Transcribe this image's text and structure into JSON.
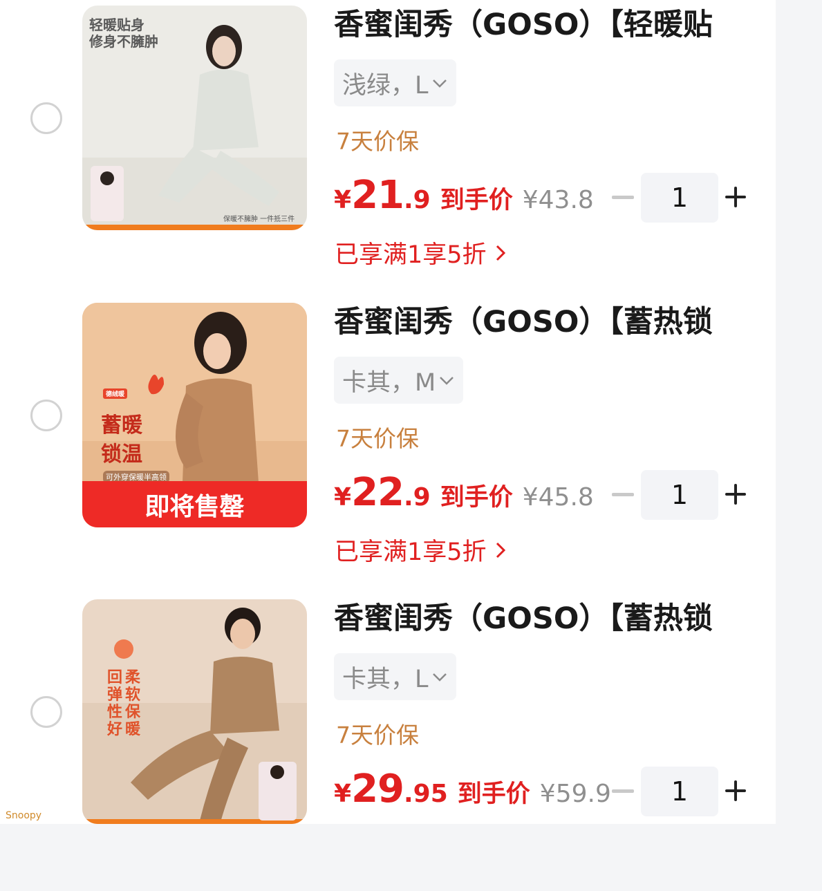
{
  "items": [
    {
      "title": "香蜜闺秀（GOSO）【轻暖贴",
      "spec": "浅绿，L",
      "guarantee": "7天价保",
      "price_yen": "¥",
      "price_int": "21",
      "price_dec": ".9",
      "price_label": "到手价",
      "original_price": "¥43.8",
      "quantity": "1",
      "discount": "已享满1享5折",
      "thumb_text_1": "轻暖贴身",
      "thumb_text_2": "修身不臃肿",
      "thumb_footer": "保暖不臃肿 一件抵三件"
    },
    {
      "title": "香蜜闺秀（GOSO）【蓄热锁",
      "spec": "卡其，M",
      "guarantee": "7天价保",
      "price_yen": "¥",
      "price_int": "22",
      "price_dec": ".9",
      "price_label": "到手价",
      "original_price": "¥45.8",
      "quantity": "1",
      "discount": "已享满1享5折",
      "thumb_badge": "德绒暖",
      "thumb_text_1": "蓄暖",
      "thumb_text_2": "锁温",
      "thumb_caption": "可外穿保暖半高领",
      "thumb_banner": "即将售罄"
    },
    {
      "title": "香蜜闺秀（GOSO）【蓄热锁",
      "spec": "卡其，L",
      "guarantee": "7天价保",
      "price_yen": "¥",
      "price_int": "29",
      "price_dec": ".95",
      "price_label": "到手价",
      "original_price": "¥59.9",
      "quantity": "1",
      "thumb_text_1": "回",
      "thumb_text_2": "弹",
      "thumb_text_3": "性",
      "thumb_text_4": "好",
      "thumb_text_5": "柔",
      "thumb_text_6": "软",
      "thumb_text_7": "保",
      "thumb_text_8": "暖"
    }
  ],
  "watermark": "Snoopy",
  "colors": {
    "price_red": "#e02020",
    "guarantee_orange": "#c8803e",
    "muted_gray": "#8f8f8f"
  }
}
